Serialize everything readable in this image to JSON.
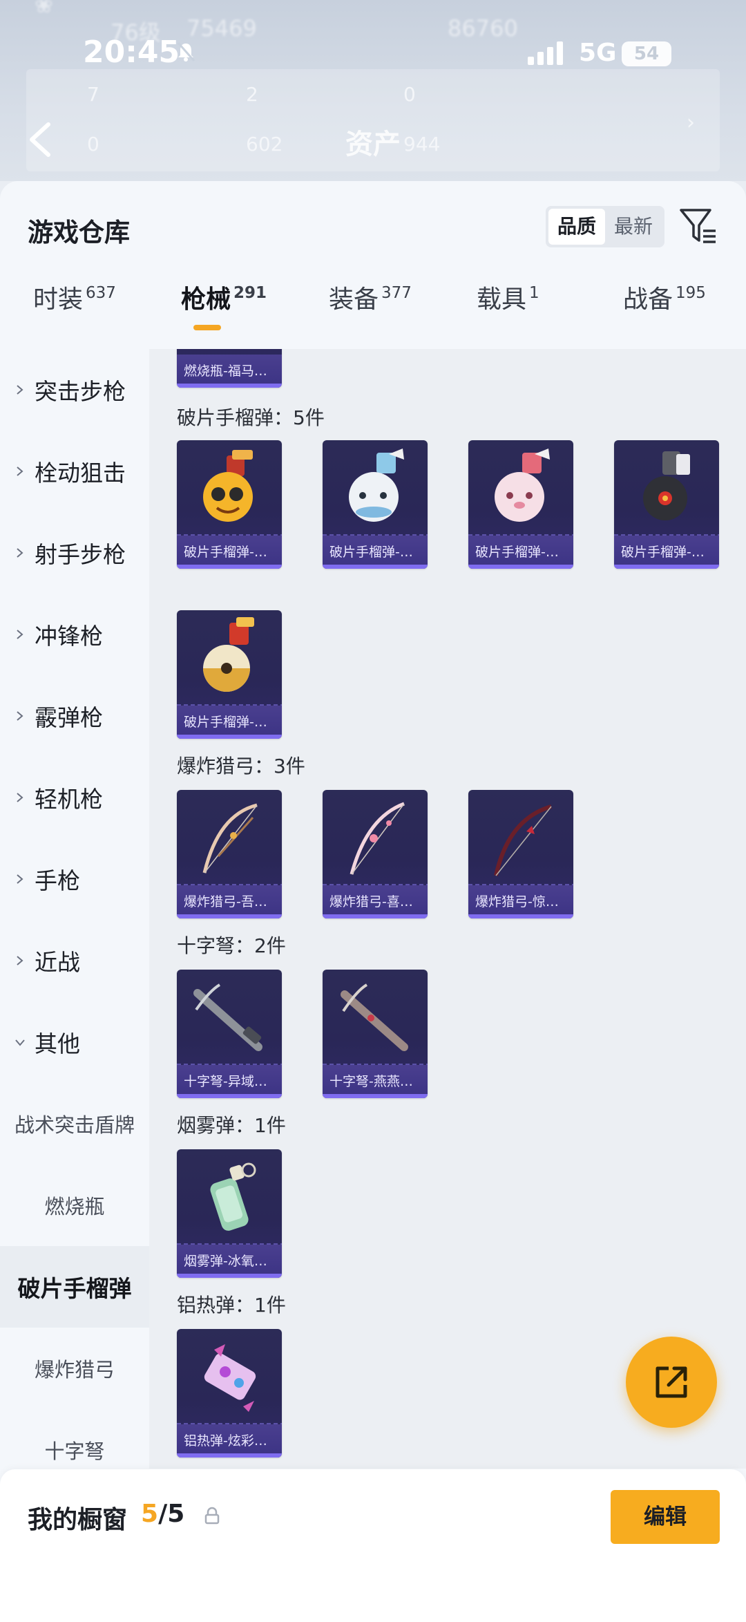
{
  "status_bar": {
    "time": "20:45",
    "network": "5G",
    "battery": "54"
  },
  "background_header": {
    "title": "资产",
    "ghost_texts": [
      "76级",
      "75469",
      "86760",
      "7",
      "2",
      "0",
      "0",
      "602",
      "944"
    ]
  },
  "warehouse": {
    "title": "游戏仓库",
    "sort_options": [
      "品质",
      "最新"
    ],
    "active_sort": "品质"
  },
  "tabs": [
    {
      "label": "时装",
      "count": "637"
    },
    {
      "label": "枪械",
      "count": "291"
    },
    {
      "label": "装备",
      "count": "377"
    },
    {
      "label": "载具",
      "count": "1"
    },
    {
      "label": "战备",
      "count": "195"
    }
  ],
  "active_tab": "枪械",
  "sidebar": {
    "categories": [
      "突击步枪",
      "栓动狙击",
      "射手步枪",
      "冲锋枪",
      "霰弹枪",
      "轻机枪",
      "手枪",
      "近战",
      "其他"
    ],
    "sub_items": [
      "战术突击盾牌",
      "燃烧瓶",
      "破片手榴弹",
      "爆炸猎弓",
      "十字弩"
    ],
    "selected": "破片手榴弹"
  },
  "groups": [
    {
      "label": "",
      "items": [
        {
          "name": "燃烧瓶-福马…",
          "icon": "molotov-icon"
        }
      ]
    },
    {
      "label": "破片手榴弹：5件",
      "items": [
        {
          "name": "破片手榴弹-…",
          "icon": "grenade-icon"
        },
        {
          "name": "破片手榴弹-…",
          "icon": "grenade-icon"
        },
        {
          "name": "破片手榴弹-…",
          "icon": "grenade-icon"
        },
        {
          "name": "破片手榴弹-…",
          "icon": "grenade-icon"
        },
        {
          "name": "破片手榴弹-…",
          "icon": "grenade-icon"
        }
      ]
    },
    {
      "label": "爆炸猎弓：3件",
      "items": [
        {
          "name": "爆炸猎弓-吾…",
          "icon": "bow-icon"
        },
        {
          "name": "爆炸猎弓-喜…",
          "icon": "bow-icon"
        },
        {
          "name": "爆炸猎弓-惊…",
          "icon": "bow-icon"
        }
      ]
    },
    {
      "label": "十字弩：2件",
      "items": [
        {
          "name": "十字弩-异域…",
          "icon": "crossbow-icon"
        },
        {
          "name": "十字弩-燕燕…",
          "icon": "crossbow-icon"
        }
      ]
    },
    {
      "label": "烟雾弹：1件",
      "items": [
        {
          "name": "烟雾弹-冰氧…",
          "icon": "smoke-grenade-icon"
        }
      ]
    },
    {
      "label": "铝热弹：1件",
      "items": [
        {
          "name": "铝热弹-炫彩…",
          "icon": "thermite-icon"
        }
      ]
    }
  ],
  "showcase": {
    "label": "我的橱窗",
    "current": "5",
    "total": "/5",
    "edit_label": "编辑"
  },
  "colors": {
    "accent": "#f7ac1f",
    "card_bg": "#2c2b57",
    "card_footer": "#4a3f8f"
  }
}
